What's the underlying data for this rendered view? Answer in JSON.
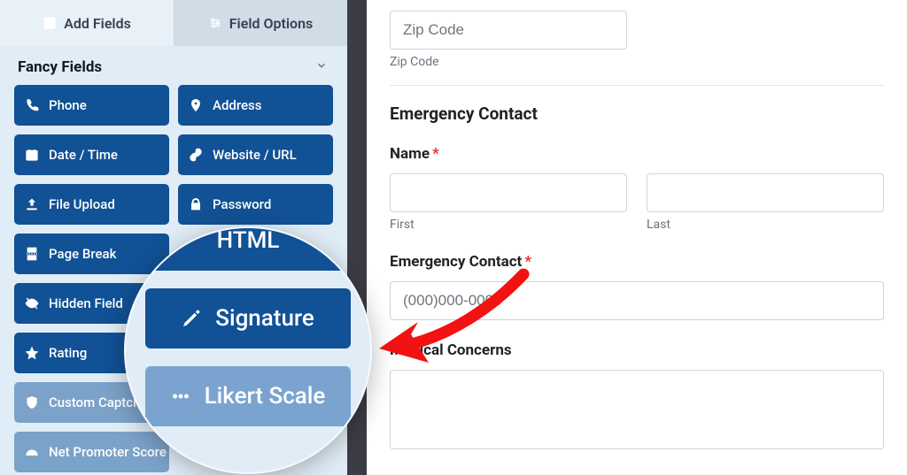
{
  "tabs": {
    "add_fields": "Add Fields",
    "field_options": "Field Options"
  },
  "section": {
    "title": "Fancy Fields"
  },
  "fields": [
    {
      "label": "Phone",
      "icon": "phone-icon"
    },
    {
      "label": "Address",
      "icon": "pin-icon"
    },
    {
      "label": "Date / Time",
      "icon": "calendar-icon"
    },
    {
      "label": "Website / URL",
      "icon": "link-icon"
    },
    {
      "label": "File Upload",
      "icon": "upload-icon"
    },
    {
      "label": "Password",
      "icon": "lock-icon"
    },
    {
      "label": "Page Break",
      "icon": "page-break-icon"
    },
    {
      "label": "",
      "icon": "",
      "hidden": true
    },
    {
      "label": "Hidden Field",
      "icon": "eye-off-icon"
    },
    {
      "label": "",
      "icon": "",
      "hidden": true
    },
    {
      "label": "Rating",
      "icon": "star-icon"
    },
    {
      "label": "",
      "icon": "",
      "hidden": true
    },
    {
      "label": "Custom Captcha",
      "icon": "shield-icon",
      "muted": true
    },
    {
      "label": "",
      "icon": "",
      "hidden": true
    },
    {
      "label": "Net Promoter Score",
      "icon": "gauge-icon",
      "muted": true
    }
  ],
  "magnify": {
    "html": "HTML",
    "signature": "Signature",
    "likert": "Likert Scale"
  },
  "preview": {
    "zip_placeholder": "Zip Code",
    "zip_sublabel": "Zip Code",
    "section_title": "Emergency Contact",
    "name_label": "Name",
    "first_sublabel": "First",
    "last_sublabel": "Last",
    "phone_label": "Emergency Contact",
    "phone_value": "(000)000-0000",
    "medical_label": "Medical Concerns"
  },
  "colors": {
    "primary": "#115195",
    "muted": "#7aa4cf",
    "panel": "#e1edf6",
    "arrow": "#f21212"
  }
}
